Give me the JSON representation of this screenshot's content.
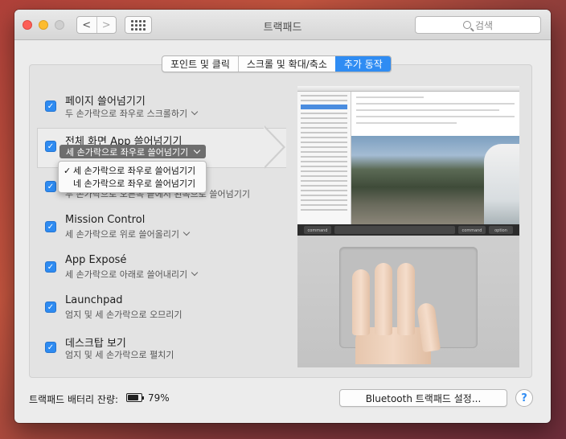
{
  "window": {
    "title": "트랙패드",
    "search_placeholder": "검색",
    "nav_back": "<",
    "nav_forward": ">"
  },
  "tabs": [
    {
      "label": "포인트 및 클릭",
      "active": false
    },
    {
      "label": "스크롤 및 확대/축소",
      "active": false
    },
    {
      "label": "추가 동작",
      "active": true
    }
  ],
  "gestures": [
    {
      "title": "페이지 쓸어넘기기",
      "subtitle": "두 손가락으로 좌우로 스크롤하기",
      "checked": true
    },
    {
      "title": "전체 화면 App 쓸어넘기기",
      "subtitle": "세 손가락으로 좌우로 쓸어넘기기",
      "checked": true
    },
    {
      "title": "",
      "subtitle": "두 손가락으로 오른쪽 끝에서 왼쪽으로 쓸어넘기기",
      "checked": true
    },
    {
      "title": "Mission Control",
      "subtitle": "세 손가락으로 위로 쓸어올리기",
      "checked": true
    },
    {
      "title": "App Exposé",
      "subtitle": "세 손가락으로 아래로 쓸어내리기",
      "checked": true
    },
    {
      "title": "Launchpad",
      "subtitle": "엄지 및 세 손가락으로 오므리기",
      "checked": true
    },
    {
      "title": "데스크탑 보기",
      "subtitle": "엄지 및 세 손가락으로 펼치기",
      "checked": true
    }
  ],
  "dropdown": {
    "options": [
      {
        "label": "세 손가락으로 좌우로 쓸어넘기기",
        "selected": true
      },
      {
        "label": "네 손가락으로 좌우로 쓸어넘기기",
        "selected": false
      }
    ]
  },
  "preview": {
    "key_command_left": "command",
    "key_command_right": "command",
    "key_option": "option"
  },
  "footer": {
    "battery_label": "트랙패드 배터리 잔량:",
    "battery_percent": "79%",
    "battery_level": 0.79,
    "bluetooth_button": "Bluetooth 트랙패드 설정...",
    "help_label": "?"
  },
  "colors": {
    "accent": "#2f8cf3",
    "close": "#fc5f57",
    "minimize": "#fdbc2e"
  }
}
